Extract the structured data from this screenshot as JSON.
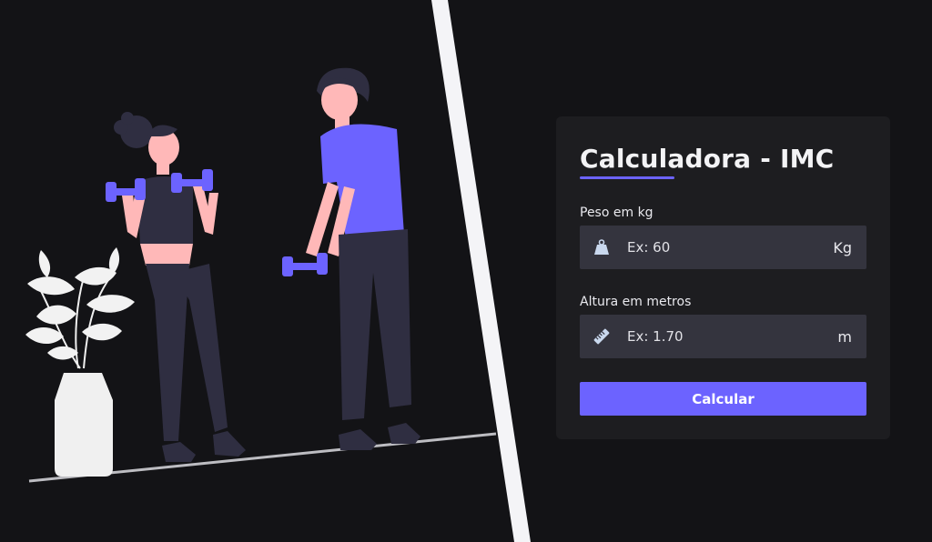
{
  "colors": {
    "background": "#131316",
    "card": "#1d1d20",
    "field": "#34343e",
    "accent": "#6c63ff",
    "text": "#f3f3f5",
    "divider": "#f4f4f7"
  },
  "form": {
    "title": "Calculadora - IMC",
    "weight": {
      "label": "Peso em kg",
      "placeholder": "Ex: 60",
      "unit": "Kg",
      "icon": "weight-icon"
    },
    "height": {
      "label": "Altura em metros",
      "placeholder": "Ex: 1.70",
      "unit": "m",
      "icon": "ruler-icon"
    },
    "submit_label": "Calcular"
  },
  "illustration": {
    "figures": [
      "woman-lifting-dumbbells",
      "man-lifting-dumbbell",
      "potted-plant"
    ]
  }
}
